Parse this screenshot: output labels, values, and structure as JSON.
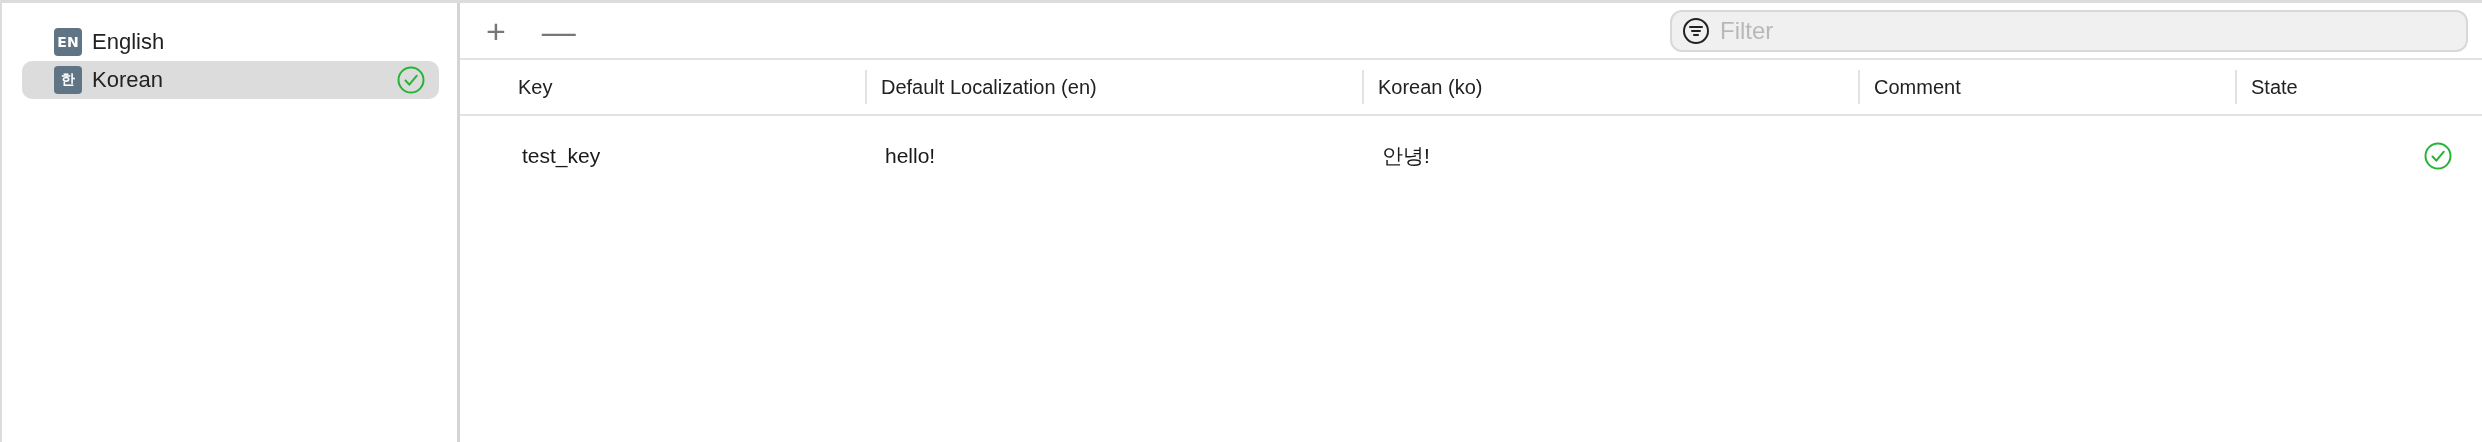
{
  "languages": [
    {
      "badge": "EN",
      "name": "English",
      "selected": false,
      "complete": false
    },
    {
      "badge": "한",
      "name": "Korean",
      "selected": true,
      "complete": true
    }
  ],
  "toolbar": {
    "add": "+",
    "remove": "—",
    "filter": {
      "placeholder": "Filter"
    }
  },
  "table": {
    "columns": [
      "Key",
      "Default Localization (en)",
      "Korean (ko)",
      "Comment",
      "State"
    ],
    "rows": [
      {
        "cells": [
          "test_key",
          "hello!",
          "안녕!",
          ""
        ],
        "complete": true
      }
    ]
  }
}
